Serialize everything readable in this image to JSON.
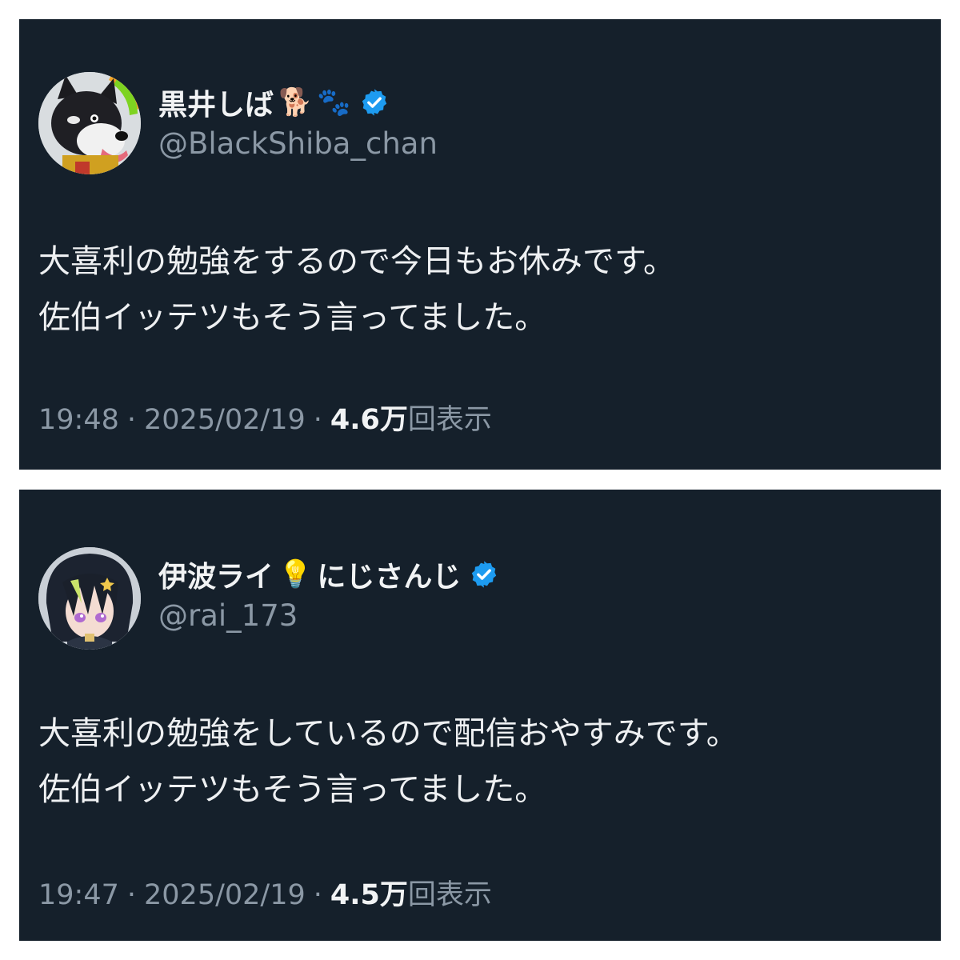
{
  "colors": {
    "card_background": "#15202b",
    "primary_text": "#e7e9ea",
    "secondary_text": "#8b98a5",
    "verified_badge": "#1d9bf0",
    "page_background": "#ffffff"
  },
  "tweets": [
    {
      "display_name": "黒井しば",
      "name_emojis": [
        "🐕",
        "🐾"
      ],
      "handle": "@BlackShiba_chan",
      "verified": true,
      "avatar_icon": "black-shiba-dog-avatar",
      "body_lines": [
        "大喜利の勉強をするので今日もお休みです。",
        "佐伯イッテツもそう言ってました。"
      ],
      "time": "19:48",
      "date": "2025/02/19",
      "views_count": "4.6万",
      "views_label": "回表示"
    },
    {
      "display_name": "伊波ライ",
      "name_emoji_mid": "💡",
      "display_name_suffix": "にじさんじ",
      "handle": "@rai_173",
      "verified": true,
      "avatar_icon": "anime-character-avatar",
      "body_lines": [
        "大喜利の勉強をしているので配信おやすみです。",
        "佐伯イッテツもそう言ってました。"
      ],
      "time": "19:47",
      "date": "2025/02/19",
      "views_count": "4.5万",
      "views_label": "回表示"
    }
  ],
  "meta_separator": "·"
}
